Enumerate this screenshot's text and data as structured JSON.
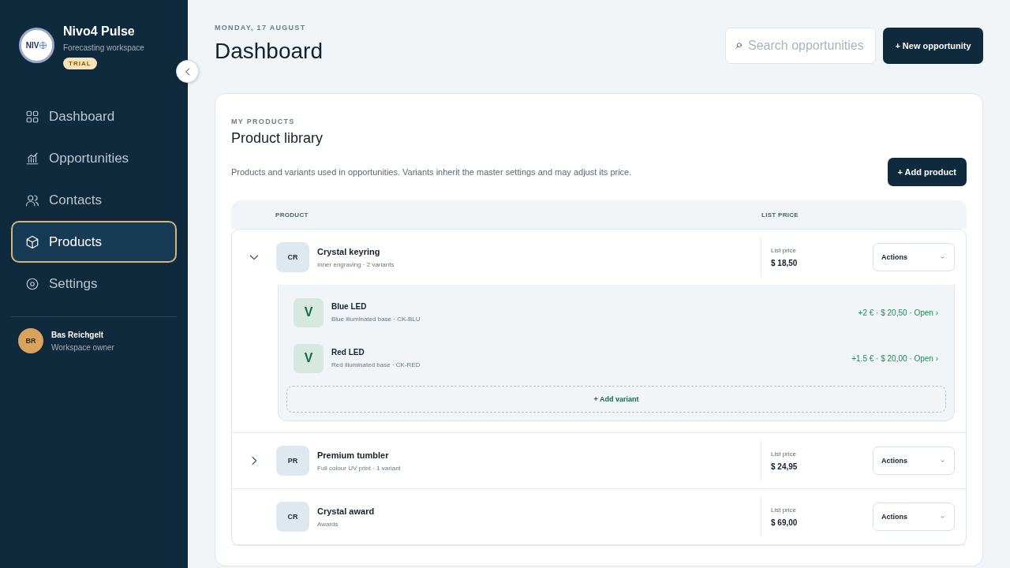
{
  "sidebar": {
    "brand": {
      "logo_text": "NIV",
      "name": "Nivo4 Pulse",
      "subtitle": "Forecasting workspace",
      "badge": "TRIAL"
    },
    "items": [
      {
        "label": "Dashboard",
        "kind": "grid",
        "selected": false
      },
      {
        "label": "Opportunities",
        "kind": "chart",
        "selected": false
      },
      {
        "label": "Contacts",
        "kind": "users",
        "selected": false
      },
      {
        "label": "Products",
        "kind": "box",
        "selected": true
      },
      {
        "label": "Settings",
        "kind": "gear",
        "selected": false
      }
    ],
    "user": {
      "initials": "BR",
      "name": "Bas Reichgelt",
      "role": "Workspace owner"
    }
  },
  "header": {
    "date": "MONDAY, 17 AUGUST",
    "title": "Dashboard",
    "search": {
      "placeholder": "Search opportunities"
    },
    "button": "+ New opportunity"
  },
  "card": {
    "eyebrow": "MY PRODUCTS",
    "title": "Product library",
    "description": "Products and variants used in opportunities. Variants inherit the master settings and may adjust its price.",
    "button": "+ Add product",
    "columns": [
      "PRODUCT",
      "LIST PRICE"
    ],
    "rows": [
      {
        "initials": "CR",
        "name": "Crystal keyring",
        "meta": "Inner engraving · 2 variants",
        "price_label": "List price",
        "price": "$ 18,50",
        "action": "Actions",
        "expanded": true,
        "variants": [
          {
            "initials": "V",
            "name": "Blue LED",
            "meta": "Blue illuminated base · CK-BLU",
            "price": "+2 € · $ 20,50 · Open ›"
          },
          {
            "initials": "V",
            "name": "Red LED",
            "meta": "Red illuminated base · CK-RED",
            "price": "+1.5 € · $ 20,00 · Open ›"
          }
        ],
        "add_variant": "+ Add variant"
      },
      {
        "initials": "PR",
        "name": "Premium tumbler",
        "meta": "Full colour UV print · 1 variant",
        "price_label": "List price",
        "price": "$ 24,95",
        "action": "Actions",
        "expanded": false
      },
      {
        "initials": "CR",
        "name": "Crystal award",
        "meta": "Awards",
        "price_label": "List price",
        "price": "$ 69,00",
        "action": "Actions"
      }
    ]
  }
}
